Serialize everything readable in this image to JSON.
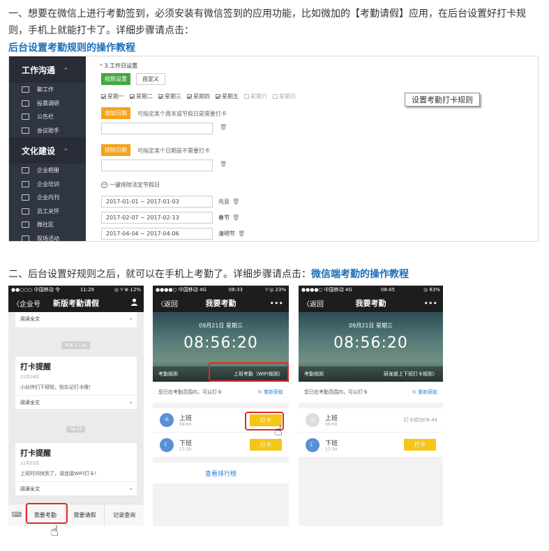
{
  "intro": {
    "para1": "一、想要在微信上进行考勤签到，必须安装有微信签到的应用功能，比如微加的【考勤请假】应用，在后台设置好打卡规则，手机上就能打卡了。详细步骤请点击：",
    "link1": "后台设置考勤规则的操作教程",
    "para2": "二、后台设置好规则之后，就可以在手机上考勤了。详细步骤请点击：",
    "link2": "微信端考勤的操作教程"
  },
  "admin": {
    "sidebar": {
      "group1": "工作沟通",
      "group1_items": [
        "聊工作",
        "投票调研",
        "公告栏",
        "会议助手"
      ],
      "group2": "文化建设",
      "group2_items": [
        "企业相册",
        "企业培训",
        "企业内刊",
        "员工关怀",
        "微社区",
        "现场活动"
      ]
    },
    "workday_label": "3.工作日设置",
    "btn_legal": "按照设置",
    "btn_custom": "自定义",
    "weekdays": [
      {
        "label": "星期一",
        "checked": true
      },
      {
        "label": "星期二",
        "checked": true
      },
      {
        "label": "星期三",
        "checked": true
      },
      {
        "label": "星期四",
        "checked": true
      },
      {
        "label": "星期五",
        "checked": true
      },
      {
        "label": "星期六",
        "checked": false
      },
      {
        "label": "星期日",
        "checked": false
      }
    ],
    "add_date_btn": "增加日期",
    "add_date_hint": "可指定某个周末或节假日是需要打卡",
    "exclude_date_btn": "排除日期",
    "exclude_date_hint": "可指定某个日期是不需要打卡",
    "legal_holiday_link": "一键排除法定节假日",
    "holidays": [
      {
        "range": "2017-01-01 ~ 2017-01-03",
        "name": "元旦"
      },
      {
        "range": "2017-02-07 ~ 2017-02-13",
        "name": "春节"
      },
      {
        "range": "2017-04-04 ~ 2017-04-06",
        "name": "清明节"
      }
    ],
    "trash_icon": "🗑",
    "tooltip": "设置考勤打卡规则"
  },
  "phone1": {
    "status_left": "●●○○○ 中国移动 令",
    "status_time": "11:29",
    "status_right": "◎ ⅟ ⊕ 12%",
    "back": "〈企业号",
    "title": "新版考勤请假",
    "read_all": "阅读全文",
    "pill1": "昨天 17:35",
    "card1": {
      "title": "打卡提醒",
      "date": "11月24日",
      "body": "小伙伴们下班啦，别忘记打卡哦！",
      "read": "阅读全文"
    },
    "pill2": "08:55",
    "card2": {
      "title": "打卡提醒",
      "date": "11月25日",
      "body": "上班时间快到了，请连接WIFI打卡！",
      "read": "阅读全文"
    },
    "tabs": [
      "我要考勤",
      "我要请假",
      "记录查询"
    ]
  },
  "phone2": {
    "status_left": "●●●●○ 中国移动 4G",
    "status_time": "08:33",
    "status_right": "⅟ ◎ 23%",
    "back": "〈返回",
    "title": "我要考勤",
    "menu": "•••",
    "date": "09月21日 星期三",
    "clock": "08:56:20",
    "rule_label": "考勤规则",
    "rule_value": "上班考勤（WIFI规则）",
    "in_range": "您已在考勤范围内，可以打卡",
    "refresh": "重新获取",
    "shift_on": {
      "name": "上班",
      "time": "09:00",
      "btn": "打卡"
    },
    "shift_off": {
      "name": "下班",
      "time": "17:30",
      "btn": "打卡"
    },
    "rank": "查看排行榜"
  },
  "phone3": {
    "status_left": "●●●●○ 中国移动 4G",
    "status_time": "08:45",
    "status_right": "◎ 83%",
    "back": "〈返回",
    "title": "我要考勤",
    "menu": "•••",
    "date": "09月21日 星期三",
    "clock": "08:56:20",
    "rule_label": "考勤规则",
    "rule_value": "研发部上下班打卡规则〉",
    "in_range": "您已在考勤范围内，可以打卡",
    "refresh": "重新获取",
    "shift_on": {
      "name": "上班",
      "time": "09:00",
      "status": "打卡成功08:44"
    },
    "shift_off": {
      "name": "下班",
      "time": "17:30",
      "btn": "打卡"
    }
  },
  "icons": {
    "hand": "☝",
    "refresh": "↻",
    "sun": "☼",
    "moon": "☾",
    "chevron": "›"
  },
  "colors": {
    "link": "#1d6fb8",
    "green": "#41a940",
    "orange": "#f5a21b",
    "punch": "#f5c518",
    "highlight": "#e02828"
  }
}
